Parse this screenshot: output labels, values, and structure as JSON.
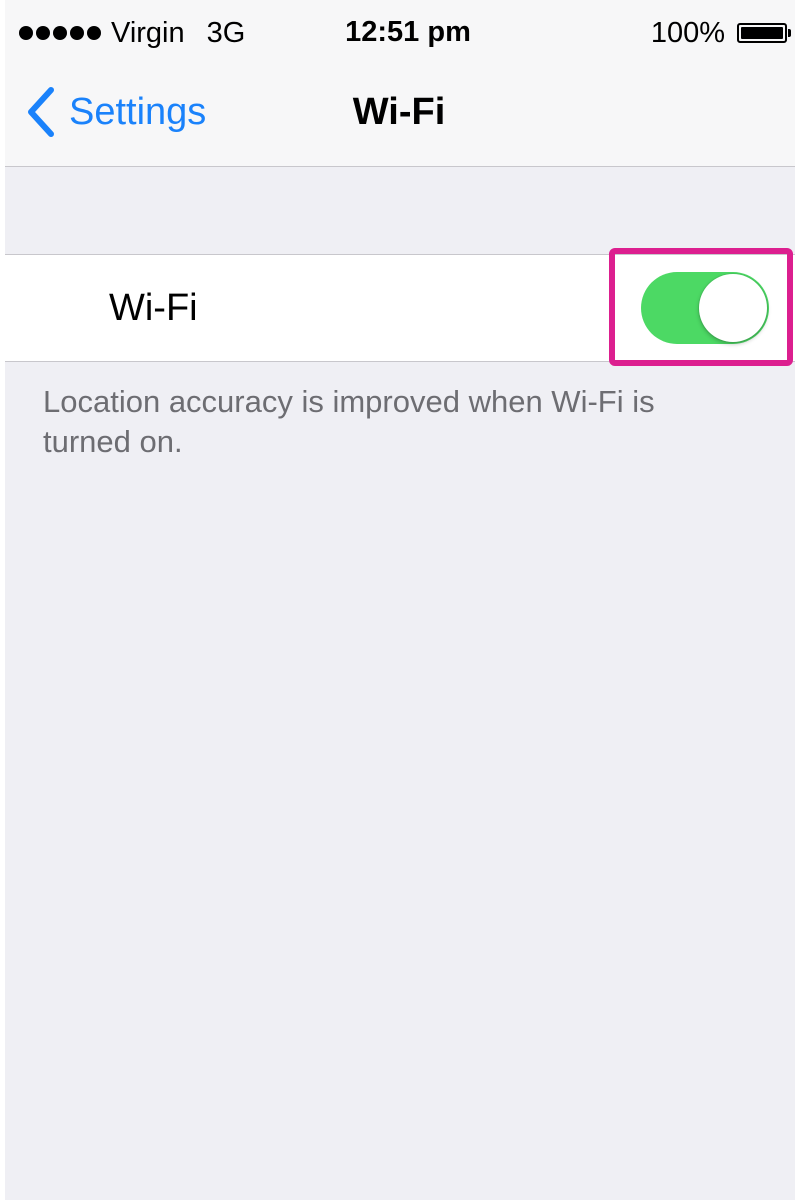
{
  "status_bar": {
    "signal_strength": 5,
    "carrier": "Virgin",
    "network": "3G",
    "time": "12:51 pm",
    "battery_percent": "100%",
    "battery_level": 1.0
  },
  "nav_bar": {
    "back_label": "Settings",
    "back_icon": "chevron-left-icon",
    "title": "Wi-Fi"
  },
  "wifi_row": {
    "label": "Wi-Fi",
    "toggle_on": true
  },
  "footer": {
    "text": "Location accuracy is improved when Wi-Fi is turned on."
  },
  "colors": {
    "accent": "#1a82fb",
    "toggle_on": "#4cd964",
    "highlight": "#dc1f8f",
    "background": "#efeff4"
  }
}
